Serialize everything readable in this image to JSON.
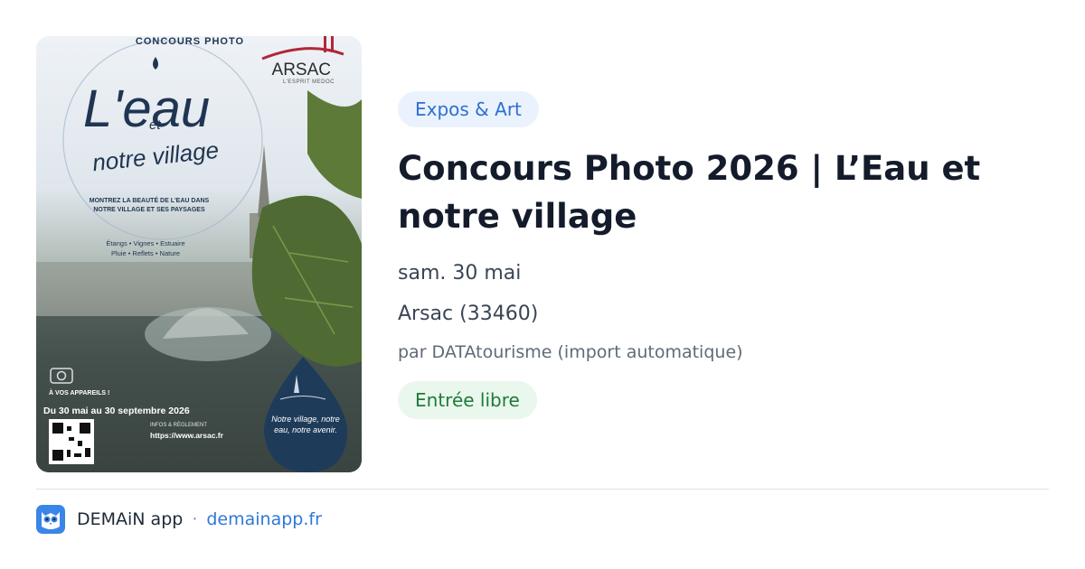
{
  "poster": {
    "kicker": "CONCOURS PHOTO",
    "title": "L'eau",
    "et": "et",
    "subtitle": "notre village",
    "brand": "ARSAC",
    "brand_sub": "L'ESPRIT MEDOC",
    "tagline": "MONTREZ LA BEAUTÉ DE L'EAU DANS NOTRE VILLAGE ET SES PAYSAGES",
    "themes_line1": "Étangs • Vignes • Estuaire",
    "themes_line2": "Pluie • Reflets • Nature",
    "call": "À VOS APPAREILS !",
    "dates": "Du  30 mai au 30 septembre 2026",
    "info_label": "INFOS & RÈGLEMENT",
    "url": "https://www.arsac.fr",
    "drop_text": "Notre village, notre eau, notre avenir."
  },
  "event": {
    "category": "Expos & Art",
    "title": "Concours Photo 2026 | L’Eau et notre village",
    "date": "sam. 30 mai",
    "location": "Arsac (33460)",
    "source": "par DATAtourisme (import automatique)",
    "price": "Entrée libre"
  },
  "footer": {
    "app_name": "DEMAiN app",
    "separator": "·",
    "link": "demainapp.fr"
  },
  "colors": {
    "category_chip_bg": "#eaf2fd",
    "category_chip_text": "#2f6fd0",
    "price_chip_bg": "#eaf7ed",
    "price_chip_text": "#1e7a3a",
    "link": "#2f78d8",
    "app_icon": "#3a86e8"
  },
  "icons": {
    "app_icon": "owl-mascot-icon"
  }
}
